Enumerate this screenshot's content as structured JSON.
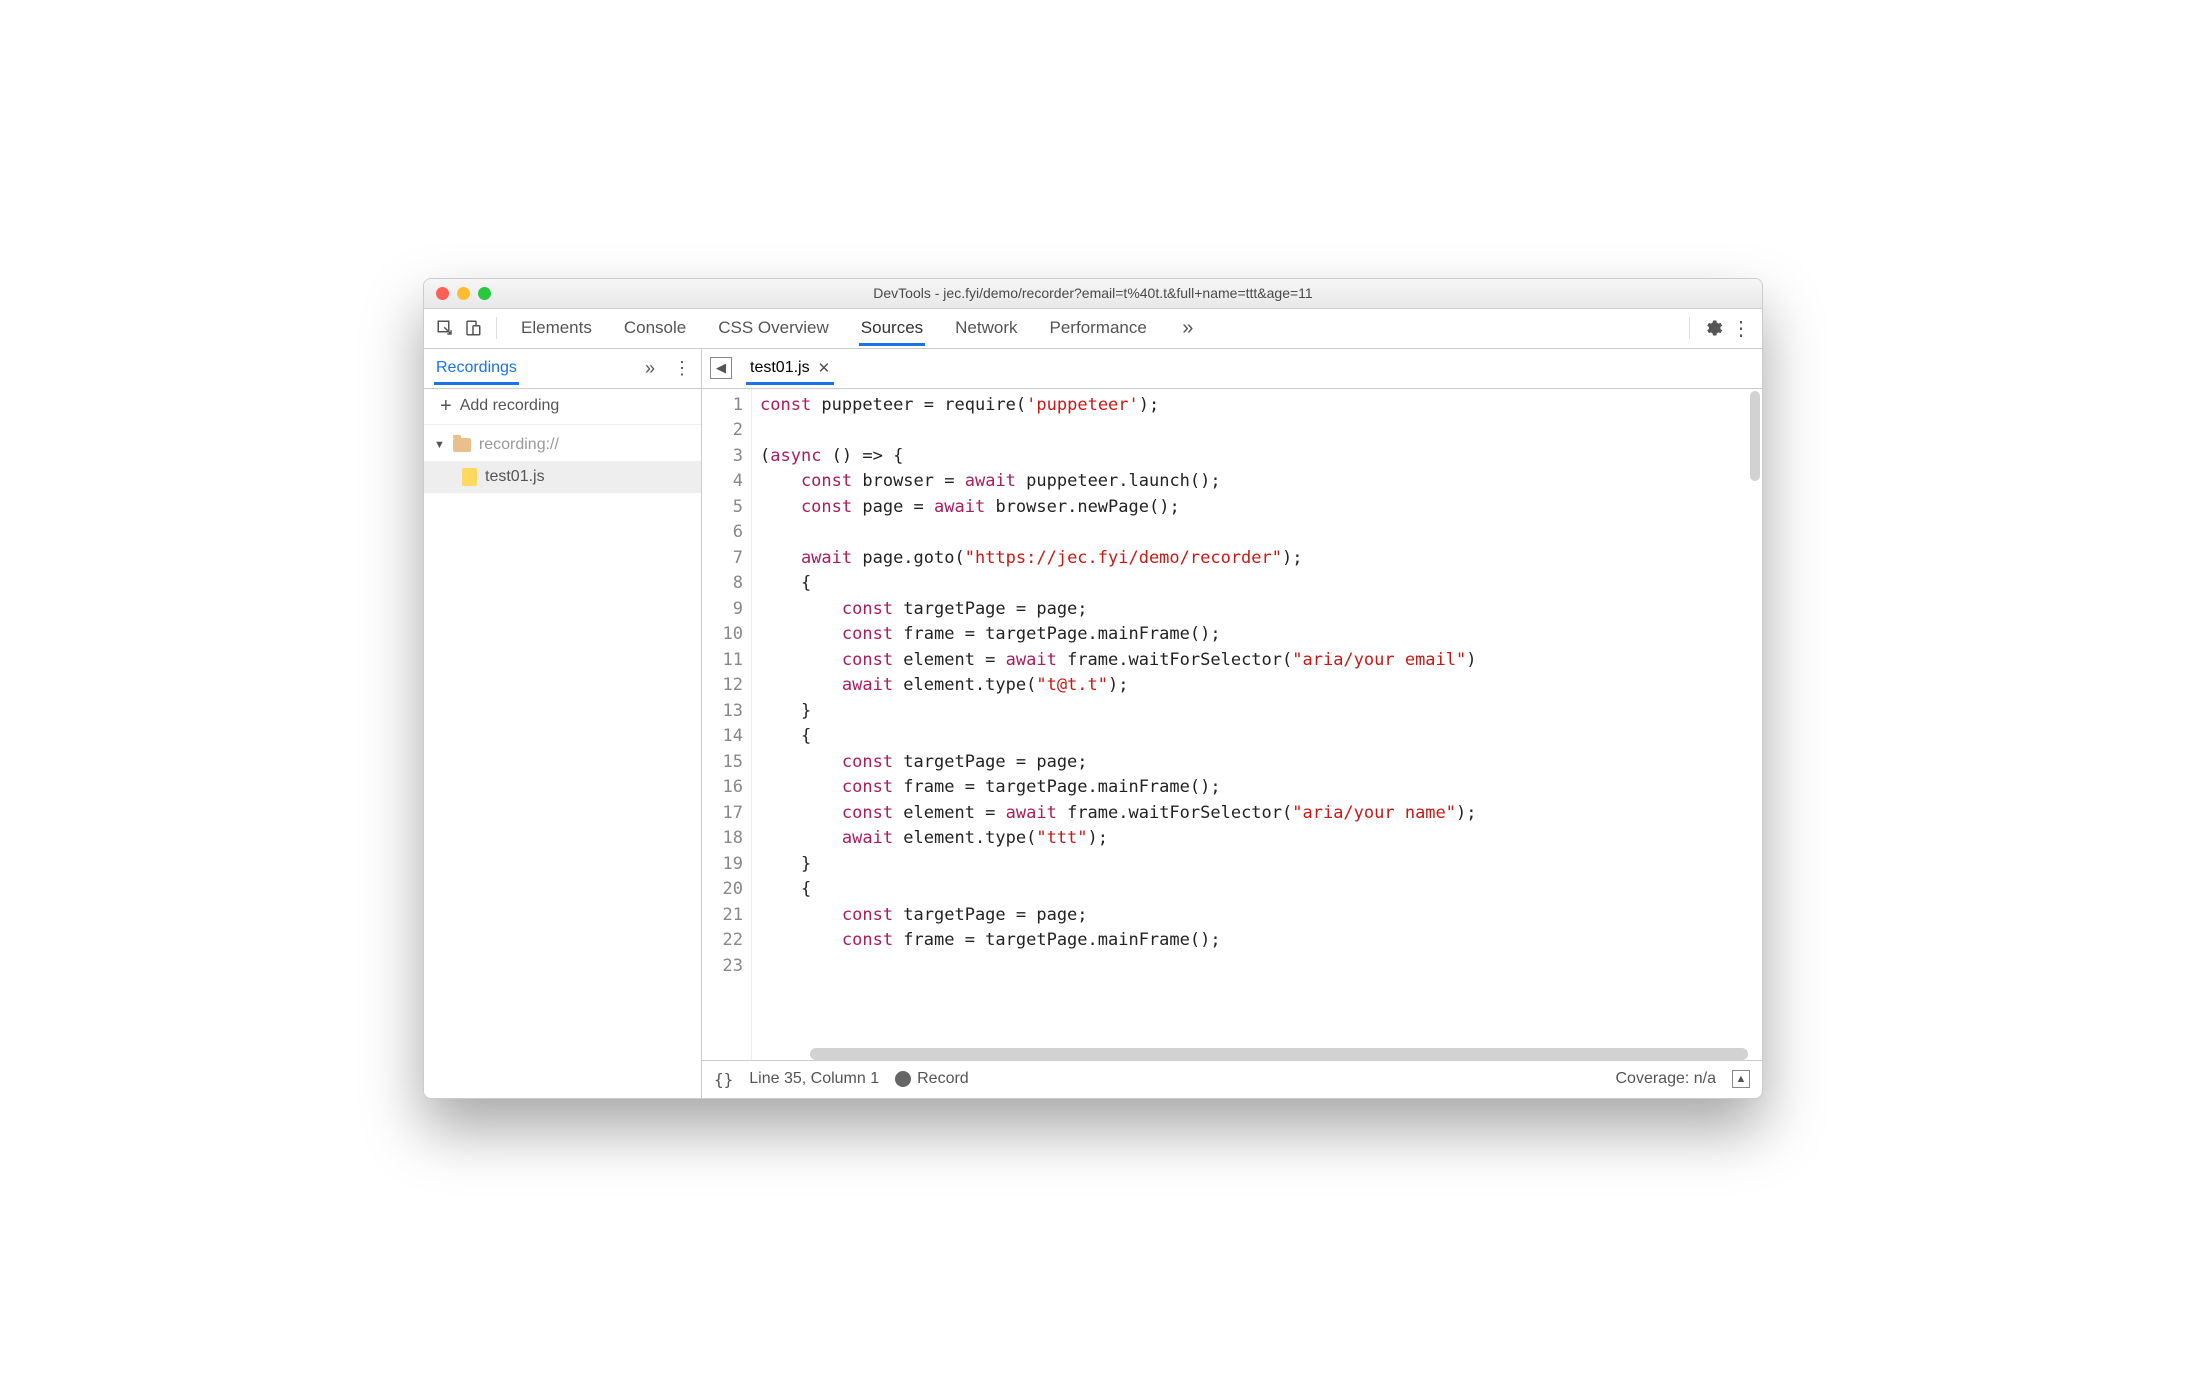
{
  "window_title": "DevTools - jec.fyi/demo/recorder?email=t%40t.t&full+name=ttt&age=11",
  "top_tabs": [
    "Elements",
    "Console",
    "CSS Overview",
    "Sources",
    "Network",
    "Performance"
  ],
  "top_active": "Sources",
  "sidebar": {
    "tab_label": "Recordings",
    "add_label": "Add recording",
    "tree_root": "recording://",
    "tree_file": "test01.js"
  },
  "editor": {
    "tab_file": "test01.js",
    "line_numbers": [
      1,
      2,
      3,
      4,
      5,
      6,
      7,
      8,
      9,
      10,
      11,
      12,
      13,
      14,
      15,
      16,
      17,
      18,
      19,
      20,
      21,
      22,
      23
    ],
    "code": {
      "l1a": "const ",
      "l1b": "puppeteer",
      "l1c": " = ",
      "l1d": "require",
      "l1e": "(",
      "l1f": "'puppeteer'",
      "l1g": ");",
      "l3a": "(",
      "l3b": "async ",
      "l3c": "() => {",
      "l4a": "    const ",
      "l4b": "browser",
      "l4c": " = ",
      "l4d": "await ",
      "l4e": "puppeteer.launch();",
      "l5a": "    const ",
      "l5b": "page",
      "l5c": " = ",
      "l5d": "await ",
      "l5e": "browser.newPage();",
      "l7a": "    await ",
      "l7b": "page.goto(",
      "l7c": "\"https://jec.fyi/demo/recorder\"",
      "l7d": ");",
      "l8": "    {",
      "l9a": "        const ",
      "l9b": "targetPage = page;",
      "l10a": "        const ",
      "l10b": "frame = targetPage.mainFrame();",
      "l11a": "        const ",
      "l11b": "element = ",
      "l11c": "await ",
      "l11d": "frame.waitForSelector(",
      "l11e": "\"aria/your email\"",
      "l11f": ")",
      "l12a": "        await ",
      "l12b": "element.type(",
      "l12c": "\"t@t.t\"",
      "l12d": ");",
      "l13": "    }",
      "l14": "    {",
      "l15a": "        const ",
      "l15b": "targetPage = page;",
      "l16a": "        const ",
      "l16b": "frame = targetPage.mainFrame();",
      "l17a": "        const ",
      "l17b": "element = ",
      "l17c": "await ",
      "l17d": "frame.waitForSelector(",
      "l17e": "\"aria/your name\"",
      "l17f": ");",
      "l18a": "        await ",
      "l18b": "element.type(",
      "l18c": "\"ttt\"",
      "l18d": ");",
      "l19": "    }",
      "l20": "    {",
      "l21a": "        const ",
      "l21b": "targetPage = page;",
      "l22a": "        const ",
      "l22b": "frame = targetPage.mainFrame();"
    }
  },
  "status": {
    "format_icon": "{}",
    "cursor": "Line 35, Column 1",
    "record": "Record",
    "coverage": "Coverage: n/a"
  }
}
